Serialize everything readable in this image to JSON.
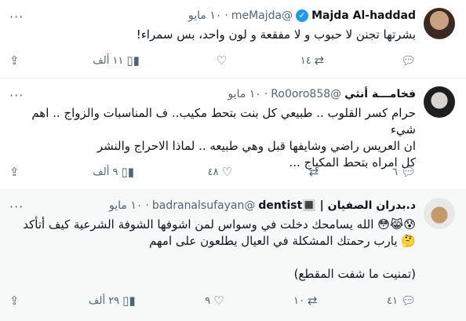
{
  "tweets": [
    {
      "name": "Majda Al-haddad",
      "handle": "@meMajda",
      "sep": "·",
      "date": "١٠ مايو",
      "text": "بشرتها تجنن لا حبوب و لا مفقعة و لون واحد، بس سمراء!",
      "actions": {
        "replies": "",
        "retweets": "١٤",
        "likes": "",
        "views": "١١ ألف"
      }
    },
    {
      "name": "فخامـــة أنثي",
      "handle": "@Ro0oro858",
      "sep": "·",
      "date": "١٠ مايو",
      "text": "حرام كسر القلوب .. طبيعي كل بنت بتحط مكيب.. ف المناسبات والزواج .. اهم شيء\nان العريس راضي وشايفها قبل وهي طبيعه .. لماذا الاحراج والنشر\nكل امراه بتحط المكياج ...",
      "actions": {
        "replies": "٦",
        "retweets": "",
        "likes": "٤٨",
        "views": "٩ ألف"
      }
    },
    {
      "name": "د.بدران الصفيان | 🔳dentist",
      "handle": "@badranalsufayan",
      "sep": "·",
      "date": "١٠ مايو",
      "text": "😰😹😳 الله يسامحك دخلت في وسواس لمن اشوفها الشوفة الشرعية كيف أتأكد\n🤔 يارب رحمتك المشكلة في العيال يطلعون على امهم\n\n(تمنيت ما شفت المقطع)",
      "actions": {
        "replies": "٤١",
        "retweets": "١٠",
        "likes": "٩",
        "views": "٢٩ ألف"
      }
    }
  ],
  "icons": {
    "reply": "reply-icon",
    "retweet": "retweet-icon",
    "like": "heart-icon",
    "views": "views-icon",
    "more": "more-icon",
    "verified": "verified-badge-icon"
  },
  "colors": {
    "verified": "#1d9bf0",
    "muted": "#536471"
  }
}
